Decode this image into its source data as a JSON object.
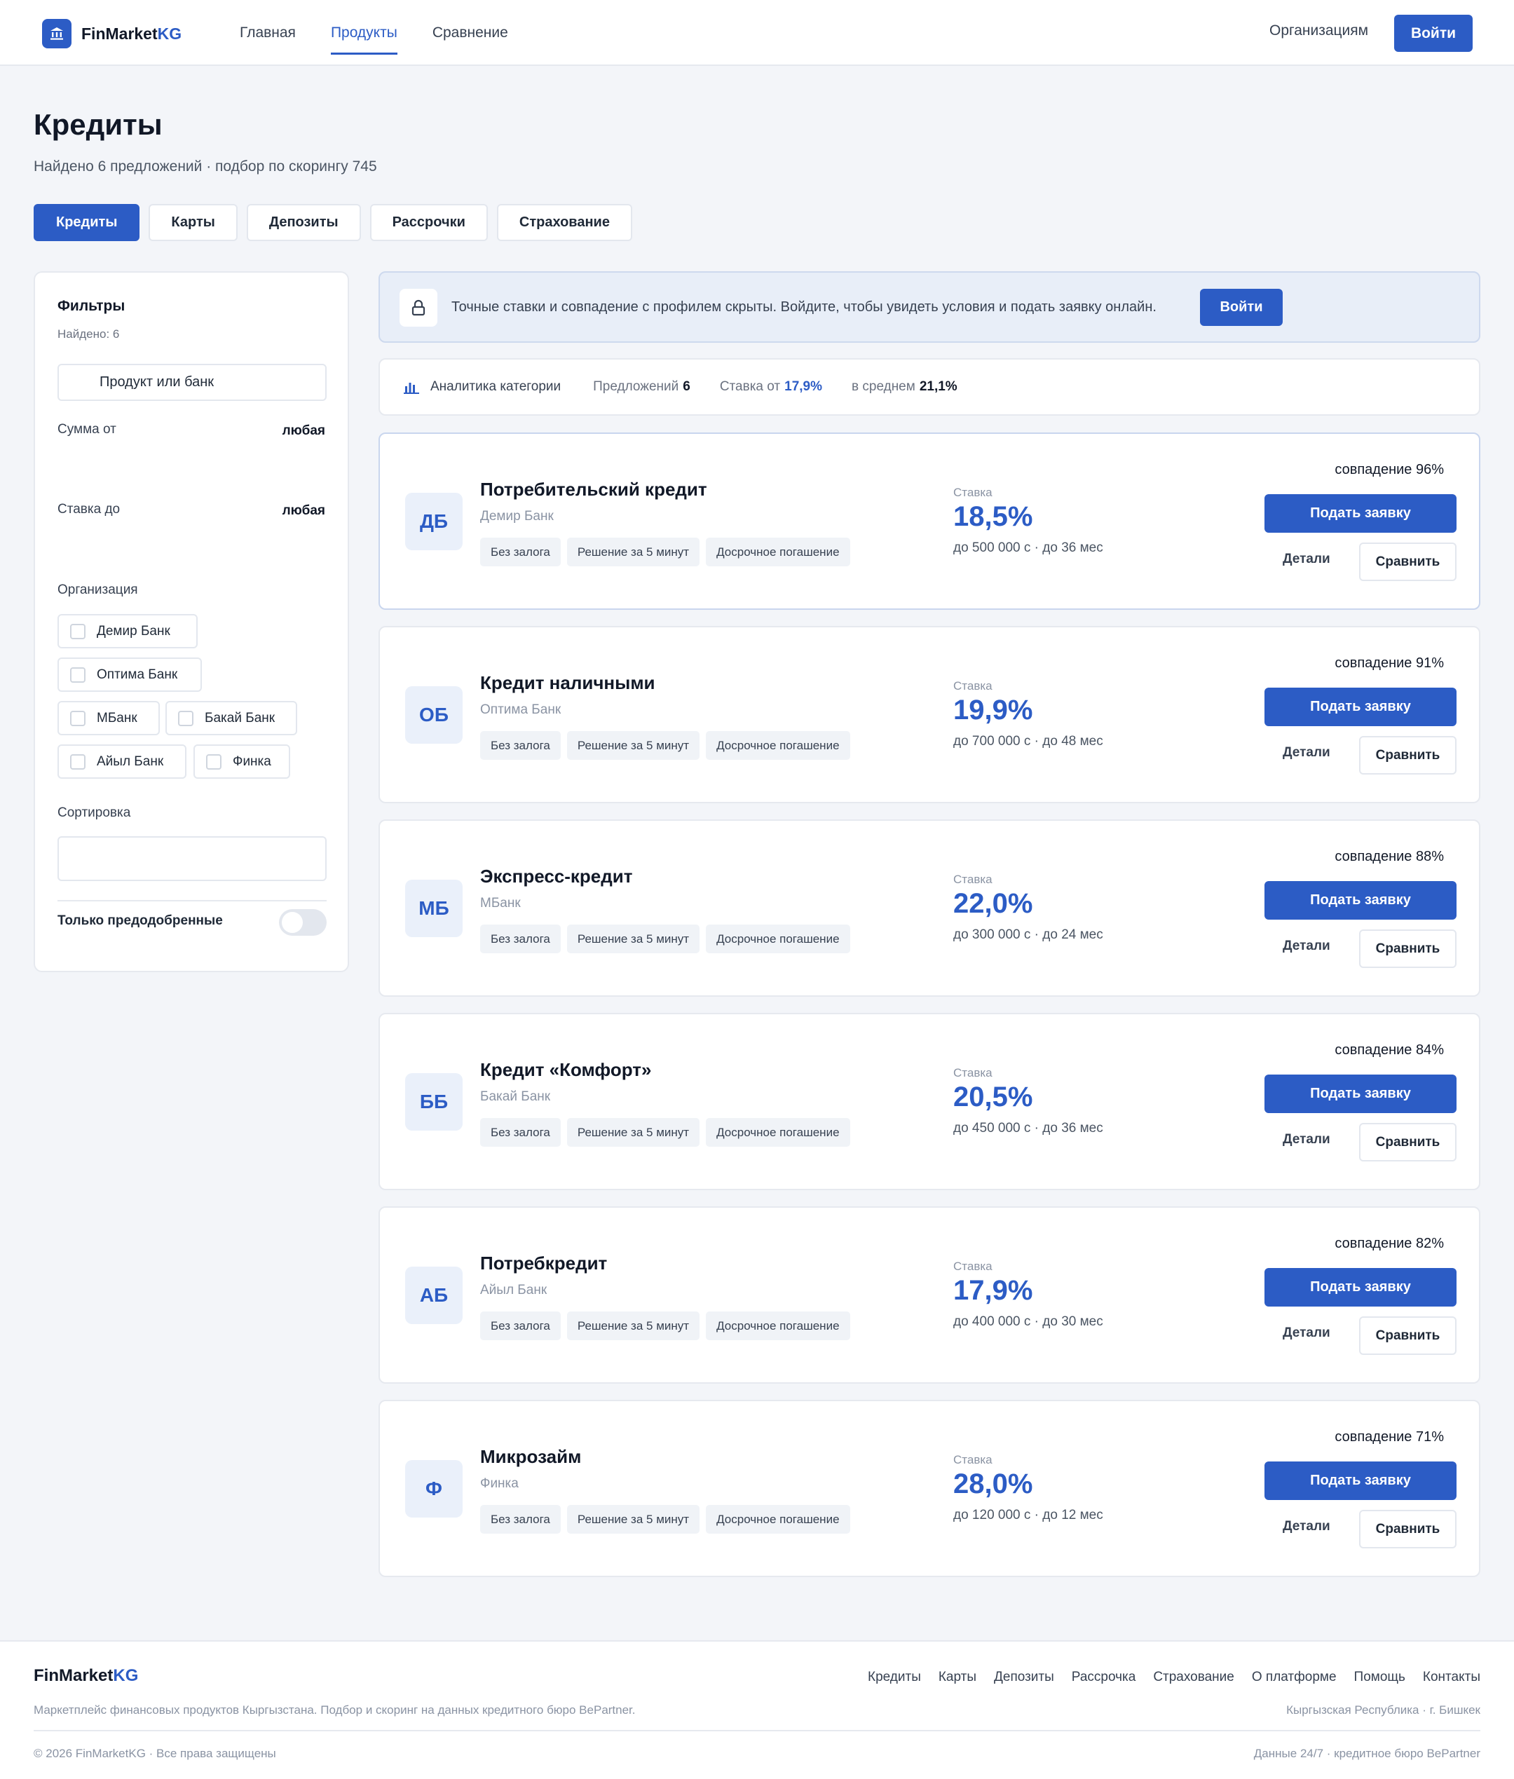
{
  "header": {
    "brand_main": "FinMarket",
    "brand_accent": "KG",
    "nav": [
      {
        "label": "Главная"
      },
      {
        "label": "Продукты",
        "active": true
      },
      {
        "label": "Сравнение"
      }
    ],
    "org_link": "Организациям",
    "login": "Войти"
  },
  "page": {
    "title": "Кредиты",
    "subtitle": "Найдено 6 предложений · подбор по скорингу 745",
    "tabs": [
      "Кредиты",
      "Карты",
      "Депозиты",
      "Рассрочки",
      "Страхование"
    ]
  },
  "filters": {
    "title": "Фильтры",
    "found": "Найдено: 6",
    "search_placeholder": "Продукт или банк",
    "amount_label": "Сумма от",
    "amount_value": "любая",
    "rate_label": "Ставка до",
    "rate_value": "любая",
    "org_label": "Организация",
    "orgs": [
      "Демир Банк",
      "Оптима Банк",
      "МБанк",
      "Бакай Банк",
      "Айыл Банк",
      "Финка"
    ],
    "sort_label": "Сортировка",
    "preapproved_label": "Только предодобренные",
    "preapproved_on": false
  },
  "banner": {
    "message": "Точные ставки и совпадение с профилем скрыты. Войдите, чтобы увидеть условия и подать заявку онлайн.",
    "login": "Войти"
  },
  "analytics": {
    "title": "Аналитика категории",
    "offers_label": "Предложений",
    "offers_value": "6",
    "rate_from_label": "Ставка от",
    "rate_from_value": "17,9%",
    "avg_label": "в среднем",
    "avg_value": "21,1%"
  },
  "product_labels": {
    "rate_label": "Ставка",
    "apply": "Подать заявку",
    "details": "Детали",
    "compare": "Сравнить"
  },
  "products": [
    {
      "initials": "ДБ",
      "name": "Потребительский кредит",
      "bank": "Демир Банк",
      "tags": [
        "Без залога",
        "Решение за 5 минут",
        "Досрочное погашение"
      ],
      "rate": "18,5%",
      "terms": "до 500 000 с · до 36 мес",
      "match": "совпадение 96%"
    },
    {
      "initials": "ОБ",
      "name": "Кредит наличными",
      "bank": "Оптима Банк",
      "tags": [
        "Без залога",
        "Решение за 5 минут",
        "Досрочное погашение"
      ],
      "rate": "19,9%",
      "terms": "до 700 000 с · до 48 мес",
      "match": "совпадение 91%"
    },
    {
      "initials": "МБ",
      "name": "Экспресс-кредит",
      "bank": "МБанк",
      "tags": [
        "Без залога",
        "Решение за 5 минут",
        "Досрочное погашение"
      ],
      "rate": "22,0%",
      "terms": "до 300 000 с · до 24 мес",
      "match": "совпадение 88%"
    },
    {
      "initials": "ББ",
      "name": "Кредит «Комфорт»",
      "bank": "Бакай Банк",
      "tags": [
        "Без залога",
        "Решение за 5 минут",
        "Досрочное погашение"
      ],
      "rate": "20,5%",
      "terms": "до 450 000 с · до 36 мес",
      "match": "совпадение 84%"
    },
    {
      "initials": "АБ",
      "name": "Потребкредит",
      "bank": "Айыл Банк",
      "tags": [
        "Без залога",
        "Решение за 5 минут",
        "Досрочное погашение"
      ],
      "rate": "17,9%",
      "terms": "до 400 000 с · до 30 мес",
      "match": "совпадение 82%"
    },
    {
      "initials": "Ф",
      "name": "Микрозайм",
      "bank": "Финка",
      "tags": [
        "Без залога",
        "Решение за 5 минут",
        "Досрочное погашение"
      ],
      "rate": "28,0%",
      "terms": "до 120 000 с · до 12 мес",
      "match": "совпадение 71%"
    }
  ],
  "footer": {
    "brand_main": "FinMarket",
    "brand_accent": "KG",
    "description": "Маркетплейс финансовых продуктов Кыргызстана. Подбор и скоринг на данных кредитного бюро BePartner.",
    "links": [
      "Кредиты",
      "Карты",
      "Депозиты",
      "Рассрочка",
      "Страхование",
      "О платформе",
      "Помощь",
      "Контакты"
    ],
    "region": "Кыргызская Республика · г. Бишкек",
    "copyright": "© 2026 FinMarketKG · Все права защищены",
    "note": "Данные 24/7 · кредитное бюро BePartner"
  },
  "colors": {
    "accent": "#2c5cc5",
    "background": "#f3f5f9",
    "banner_bg": "#e8eef8"
  },
  "icons": {
    "logo": "bank-icon",
    "banner": "lock-icon",
    "analytics": "bar-chart-icon"
  }
}
